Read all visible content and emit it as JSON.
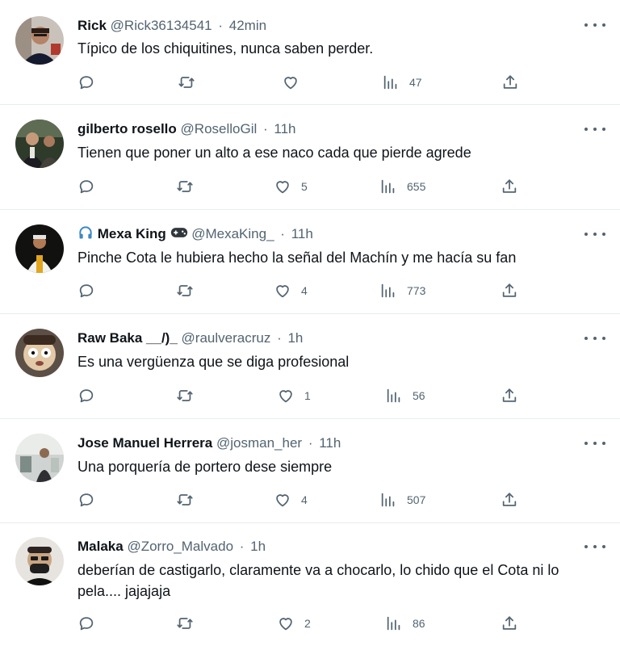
{
  "tweets": [
    {
      "name": "Rick",
      "handle": "@Rick36134541",
      "time": "42min",
      "text": "Típico de los chiquitines, nunca saben perder.",
      "stats": {
        "replies": "",
        "retweets": "",
        "likes": "",
        "views": "47"
      }
    },
    {
      "name": "gilberto rosello",
      "handle": "@RoselloGil",
      "time": "11h",
      "text": "Tienen que poner un alto a ese naco cada que pierde agrede",
      "stats": {
        "replies": "",
        "retweets": "",
        "likes": "5",
        "views": "655"
      }
    },
    {
      "name": "Mexa King",
      "handle": "@MexaKing_",
      "time": "11h",
      "text": "Pinche Cota le hubiera hecho la señal del Machín y me hacía su fan",
      "stats": {
        "replies": "",
        "retweets": "",
        "likes": "4",
        "views": "773"
      }
    },
    {
      "name": "Raw Baka __/)_",
      "handle": "@raulveracruz",
      "time": "1h",
      "text": "Es una vergüenza que se diga profesional",
      "stats": {
        "replies": "",
        "retweets": "",
        "likes": "1",
        "views": "56"
      }
    },
    {
      "name": "Jose Manuel Herrera",
      "handle": "@josman_her",
      "time": "11h",
      "text": "Una porquería de portero dese siempre",
      "stats": {
        "replies": "",
        "retweets": "",
        "likes": "4",
        "views": "507"
      }
    },
    {
      "name": "Malaka",
      "handle": "@Zorro_Malvado",
      "time": "1h",
      "text": "deberían de castigarlo, claramente va a chocarlo, lo chido que el Cota ni lo pela.... jajajaja",
      "stats": {
        "replies": "",
        "retweets": "",
        "likes": "2",
        "views": "86"
      }
    }
  ],
  "separator": "·",
  "icons": {
    "reply": "reply-icon",
    "retweet": "retweet-icon",
    "like": "like-icon",
    "views": "views-icon",
    "share": "share-icon",
    "more": "more-options-icon",
    "name_prefix": "headphones-emoji",
    "name_suffix": "game-controller-emoji"
  },
  "colors": {
    "text": "#0f1419",
    "muted": "#536471",
    "divider": "#e6ecf0",
    "background": "#ffffff"
  }
}
